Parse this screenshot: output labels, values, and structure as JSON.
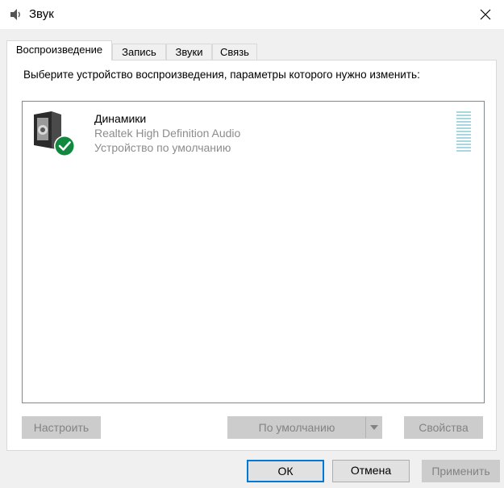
{
  "window": {
    "title": "Звук"
  },
  "tabs": [
    {
      "label": "Воспроизведение",
      "active": true
    },
    {
      "label": "Запись",
      "active": false
    },
    {
      "label": "Звуки",
      "active": false
    },
    {
      "label": "Связь",
      "active": false
    }
  ],
  "playback": {
    "instruction": "Выберите устройство воспроизведения, параметры которого нужно изменить:",
    "devices": [
      {
        "name": "Динамики",
        "driver": "Realtek High Definition Audio",
        "status": "Устройство по умолчанию",
        "icon": "speaker-icon",
        "badge": "default-checkmark-icon",
        "level_fraction": 0
      }
    ],
    "buttons": {
      "configure": "Настроить",
      "set_default": "По умолчанию",
      "properties": "Свойства"
    }
  },
  "dialog_buttons": {
    "ok": "ОК",
    "cancel": "Отмена",
    "apply": "Применить"
  },
  "colors": {
    "accent": "#0078d7",
    "check_badge": "#10893e",
    "level_meter": "#a7d8df",
    "disabled_text": "#838383"
  }
}
